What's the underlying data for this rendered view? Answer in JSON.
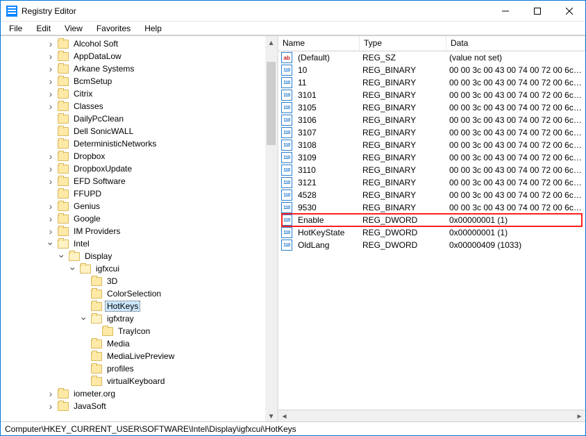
{
  "window": {
    "title": "Registry Editor"
  },
  "menu": {
    "file": "File",
    "edit": "Edit",
    "view": "View",
    "favorites": "Favorites",
    "help": "Help"
  },
  "tree": [
    {
      "depth": 4,
      "arrow": "closed",
      "label": "Alcohol Soft"
    },
    {
      "depth": 4,
      "arrow": "closed",
      "label": "AppDataLow"
    },
    {
      "depth": 4,
      "arrow": "closed",
      "label": "Arkane Systems"
    },
    {
      "depth": 4,
      "arrow": "closed",
      "label": "BcmSetup"
    },
    {
      "depth": 4,
      "arrow": "closed",
      "label": "Citrix"
    },
    {
      "depth": 4,
      "arrow": "closed",
      "label": "Classes"
    },
    {
      "depth": 4,
      "arrow": "none",
      "label": "DailyPcClean"
    },
    {
      "depth": 4,
      "arrow": "none",
      "label": "Dell SonicWALL"
    },
    {
      "depth": 4,
      "arrow": "none",
      "label": "DeterministicNetworks"
    },
    {
      "depth": 4,
      "arrow": "closed",
      "label": "Dropbox"
    },
    {
      "depth": 4,
      "arrow": "closed",
      "label": "DropboxUpdate"
    },
    {
      "depth": 4,
      "arrow": "closed",
      "label": "EFD Software"
    },
    {
      "depth": 4,
      "arrow": "none",
      "label": "FFUPD"
    },
    {
      "depth": 4,
      "arrow": "closed",
      "label": "Genius"
    },
    {
      "depth": 4,
      "arrow": "closed",
      "label": "Google"
    },
    {
      "depth": 4,
      "arrow": "closed",
      "label": "IM Providers"
    },
    {
      "depth": 4,
      "arrow": "open",
      "label": "Intel"
    },
    {
      "depth": 5,
      "arrow": "open",
      "label": "Display"
    },
    {
      "depth": 6,
      "arrow": "open",
      "label": "igfxcui"
    },
    {
      "depth": 7,
      "arrow": "none",
      "label": "3D"
    },
    {
      "depth": 7,
      "arrow": "none",
      "label": "ColorSelection"
    },
    {
      "depth": 7,
      "arrow": "none",
      "label": "HotKeys",
      "selected": true
    },
    {
      "depth": 7,
      "arrow": "open",
      "label": "igfxtray"
    },
    {
      "depth": 8,
      "arrow": "none",
      "label": "TrayIcon"
    },
    {
      "depth": 7,
      "arrow": "none",
      "label": "Media"
    },
    {
      "depth": 7,
      "arrow": "none",
      "label": "MediaLivePreview"
    },
    {
      "depth": 7,
      "arrow": "none",
      "label": "profiles"
    },
    {
      "depth": 7,
      "arrow": "none",
      "label": "virtualKeyboard"
    },
    {
      "depth": 4,
      "arrow": "closed",
      "label": "iometer.org"
    },
    {
      "depth": 4,
      "arrow": "closed",
      "label": "JavaSoft"
    }
  ],
  "list": {
    "columns": {
      "name": "Name",
      "type": "Type",
      "data": "Data"
    },
    "rows": [
      {
        "icon": "sz",
        "name": "(Default)",
        "type": "REG_SZ",
        "data": "(value not set)"
      },
      {
        "icon": "bin",
        "name": "10",
        "type": "REG_BINARY",
        "data": "00 00 3c 00 43 00 74 00 72 00 6c 00"
      },
      {
        "icon": "bin",
        "name": "11",
        "type": "REG_BINARY",
        "data": "00 00 3c 00 43 00 74 00 72 00 6c 00"
      },
      {
        "icon": "bin",
        "name": "3101",
        "type": "REG_BINARY",
        "data": "00 00 3c 00 43 00 74 00 72 00 6c 00"
      },
      {
        "icon": "bin",
        "name": "3105",
        "type": "REG_BINARY",
        "data": "00 00 3c 00 43 00 74 00 72 00 6c 00"
      },
      {
        "icon": "bin",
        "name": "3106",
        "type": "REG_BINARY",
        "data": "00 00 3c 00 43 00 74 00 72 00 6c 00"
      },
      {
        "icon": "bin",
        "name": "3107",
        "type": "REG_BINARY",
        "data": "00 00 3c 00 43 00 74 00 72 00 6c 00"
      },
      {
        "icon": "bin",
        "name": "3108",
        "type": "REG_BINARY",
        "data": "00 00 3c 00 43 00 74 00 72 00 6c 00"
      },
      {
        "icon": "bin",
        "name": "3109",
        "type": "REG_BINARY",
        "data": "00 00 3c 00 43 00 74 00 72 00 6c 00"
      },
      {
        "icon": "bin",
        "name": "3110",
        "type": "REG_BINARY",
        "data": "00 00 3c 00 43 00 74 00 72 00 6c 00"
      },
      {
        "icon": "bin",
        "name": "3121",
        "type": "REG_BINARY",
        "data": "00 00 3c 00 43 00 74 00 72 00 6c 00"
      },
      {
        "icon": "bin",
        "name": "4528",
        "type": "REG_BINARY",
        "data": "00 00 3c 00 43 00 74 00 72 00 6c 00"
      },
      {
        "icon": "bin",
        "name": "9530",
        "type": "REG_BINARY",
        "data": "00 00 3c 00 43 00 74 00 72 00 6c 00"
      },
      {
        "icon": "bin",
        "name": "Enable",
        "type": "REG_DWORD",
        "data": "0x00000001 (1)",
        "highlight": true
      },
      {
        "icon": "bin",
        "name": "HotKeyState",
        "type": "REG_DWORD",
        "data": "0x00000001 (1)"
      },
      {
        "icon": "bin",
        "name": "OldLang",
        "type": "REG_DWORD",
        "data": "0x00000409 (1033)"
      }
    ]
  },
  "status": {
    "path": "Computer\\HKEY_CURRENT_USER\\SOFTWARE\\Intel\\Display\\igfxcui\\HotKeys"
  }
}
